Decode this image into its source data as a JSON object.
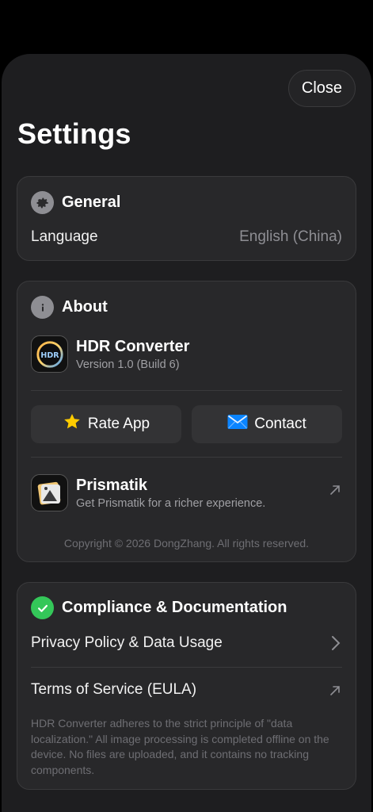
{
  "header": {
    "close_label": "Close",
    "title": "Settings"
  },
  "general": {
    "title": "General",
    "icon": "gear-icon",
    "language_label": "Language",
    "language_value": "English (China)"
  },
  "about": {
    "title": "About",
    "icon": "info-icon",
    "app_name": "HDR Converter",
    "app_version": "Version 1.0 (Build 6)",
    "app_icon_text": "HDR",
    "rate_label": "Rate App",
    "contact_label": "Contact",
    "promo_name": "Prismatik",
    "promo_sub": "Get Prismatik for a richer experience.",
    "copyright": "Copyright © 2026 DongZhang. All rights reserved."
  },
  "compliance": {
    "title": "Compliance & Documentation",
    "icon": "check-badge-icon",
    "privacy_label": "Privacy Policy & Data Usage",
    "terms_label": "Terms of Service (EULA)",
    "footnote": "HDR Converter adheres to the strict principle of \"data localization.\" All image processing is completed offline on the device. No files are uploaded, and it contains no tracking components."
  },
  "colors": {
    "accent_green": "#34c759",
    "star": "#ffcc00",
    "mail": "#0a84ff"
  }
}
